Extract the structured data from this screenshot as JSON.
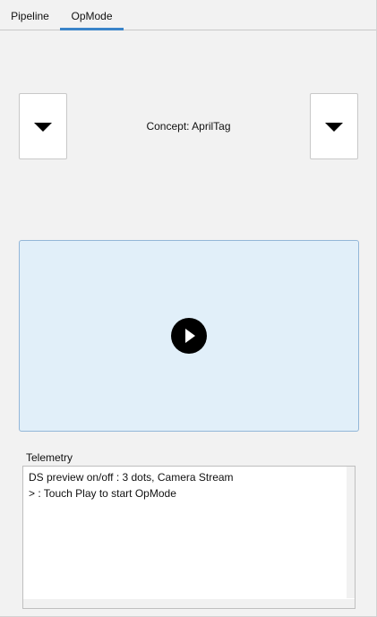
{
  "tabs": [
    {
      "label": "Pipeline",
      "active": false
    },
    {
      "label": "OpMode",
      "active": true
    }
  ],
  "opmode": {
    "selected_label": "Concept: AprilTag"
  },
  "preview": {
    "play_icon": "play-icon"
  },
  "telemetry": {
    "label": "Telemetry",
    "lines": [
      "DS preview on/off : 3 dots, Camera Stream",
      "> : Touch Play to start OpMode"
    ]
  },
  "colors": {
    "accent": "#3a84c9",
    "preview_bg": "#e1eff9",
    "preview_border": "#93b7d8",
    "window_bg": "#f2f2f2"
  }
}
